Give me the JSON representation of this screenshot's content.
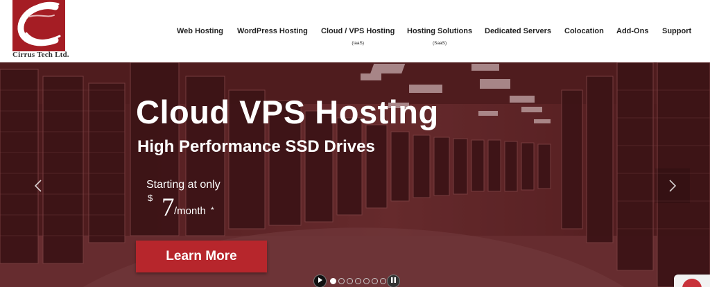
{
  "brand": {
    "name": "Cirrus Tech Ltd.",
    "logo_color": "#a51d24"
  },
  "nav": {
    "items": [
      {
        "label": "Web Hosting",
        "sub": ""
      },
      {
        "label": "WordPress Hosting",
        "sub": ""
      },
      {
        "label": "Cloud / VPS Hosting",
        "sub": "(IaaS)"
      },
      {
        "label": "Hosting Solutions",
        "sub": "(SaaS)"
      },
      {
        "label": "Dedicated Servers",
        "sub": ""
      },
      {
        "label": "Colocation",
        "sub": ""
      },
      {
        "label": "Add-Ons",
        "sub": ""
      },
      {
        "label": "Support",
        "sub": ""
      }
    ]
  },
  "hero": {
    "title": "Cloud VPS Hosting",
    "subtitle": "High Performance SSD Drives",
    "starting_text": "Starting at only",
    "currency": "$",
    "price": "7",
    "per": "/month",
    "asterisk": "*",
    "cta_label": "Learn More",
    "cta_color": "#b7262c",
    "prev_icon": "chevron-left-icon",
    "next_icon": "chevron-right-icon"
  },
  "slider": {
    "slide_count": 7,
    "active_index": 0
  }
}
